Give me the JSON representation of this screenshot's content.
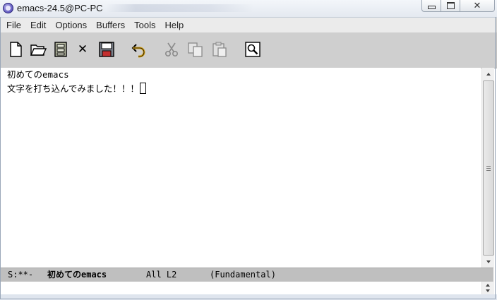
{
  "window": {
    "title": "emacs-24.5@PC-PC",
    "controls": {
      "minimize_icon": "minimize-icon",
      "maximize_icon": "maximize-icon",
      "close_icon": "close-icon",
      "close_glyph": "✕"
    }
  },
  "menu": {
    "items": [
      "File",
      "Edit",
      "Options",
      "Buffers",
      "Tools",
      "Help"
    ]
  },
  "toolbar": {
    "icons": [
      "new-file-icon",
      "open-file-icon",
      "dired-icon",
      "kill-buffer-icon",
      "save-icon",
      "undo-icon",
      "cut-icon",
      "copy-icon",
      "paste-icon",
      "search-icon"
    ],
    "kill_glyph": "✕"
  },
  "buffer": {
    "lines": [
      "初めてのemacs",
      "文字を打ち込んでみました！！！"
    ]
  },
  "modeline": {
    "status": "S:**-",
    "buffer_name": "初めてのemacs",
    "position": "All L2",
    "mode": "(Fundamental)"
  },
  "colors": {
    "toolbar_bg": "#cfcfcf",
    "menubar_bg": "#ebebeb",
    "modeline_bg": "#bfbfbf",
    "text": "#000000"
  }
}
